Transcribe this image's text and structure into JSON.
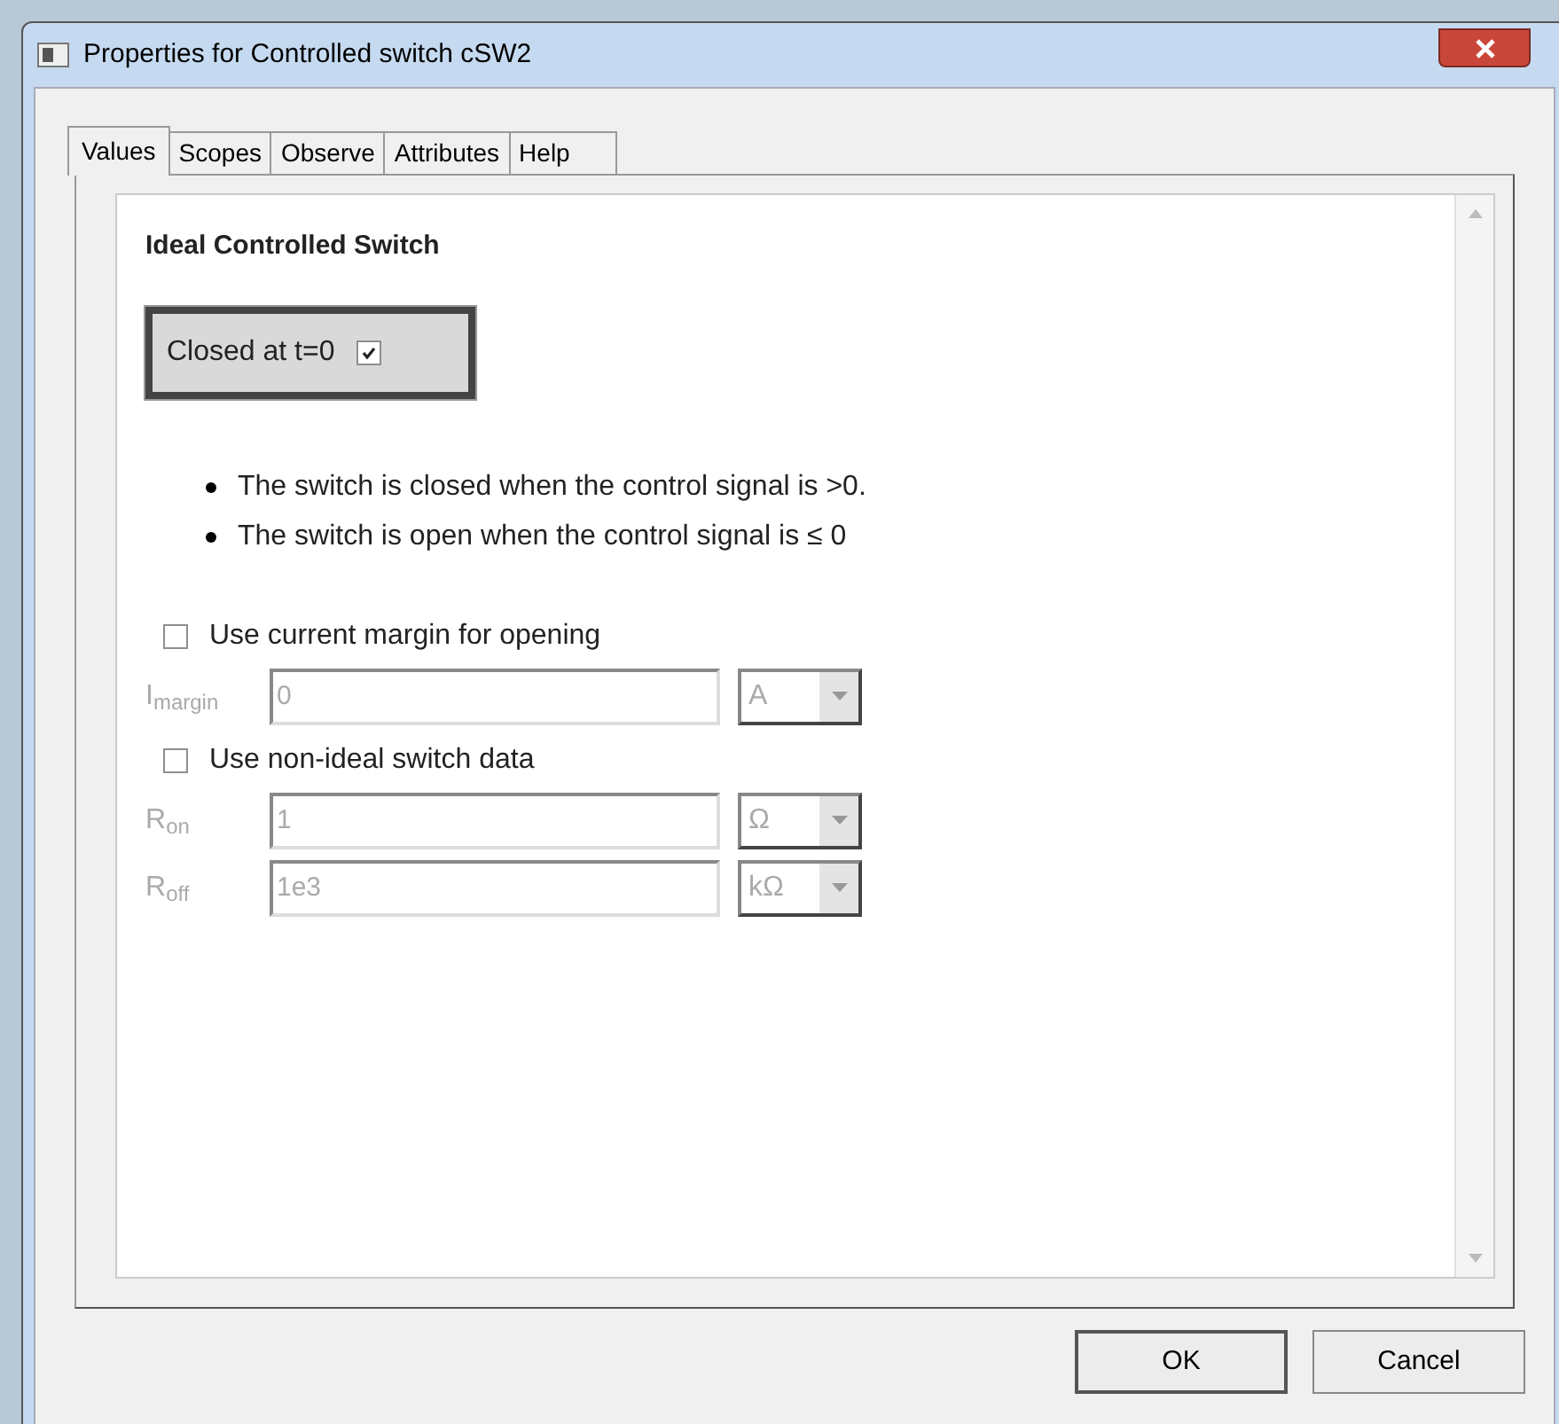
{
  "window": {
    "title": "Properties for Controlled switch cSW2"
  },
  "tabs": [
    {
      "label": "Values",
      "selected": true
    },
    {
      "label": "Scopes",
      "selected": false
    },
    {
      "label": "Observe",
      "selected": false
    },
    {
      "label": "Attributes",
      "selected": false
    },
    {
      "label": "Help",
      "selected": false
    }
  ],
  "heading": "Ideal Controlled Switch",
  "closed_at_t0": {
    "label": "Closed at t=0",
    "checked": true
  },
  "notes": [
    "The switch is closed when the control signal is >0.",
    "The switch is open when the control signal is ≤ 0"
  ],
  "sections": [
    {
      "option": {
        "label": "Use current margin for opening",
        "checked": false
      },
      "fields": [
        {
          "label": "I$_{margin}$",
          "value": "0",
          "unit": "A",
          "disabled": true
        }
      ]
    },
    {
      "option": {
        "label": "Use non-ideal switch data",
        "checked": false
      },
      "fields": [
        {
          "label": "R$_{on}$",
          "value": "1",
          "unit": "Ω",
          "disabled": true
        },
        {
          "label": "R$_{off}$",
          "value": "1e3",
          "unit": "kΩ",
          "disabled": true
        }
      ]
    }
  ],
  "buttons": [
    {
      "label": "OK",
      "kind": "default"
    },
    {
      "label": "Cancel",
      "kind": "normal"
    }
  ]
}
